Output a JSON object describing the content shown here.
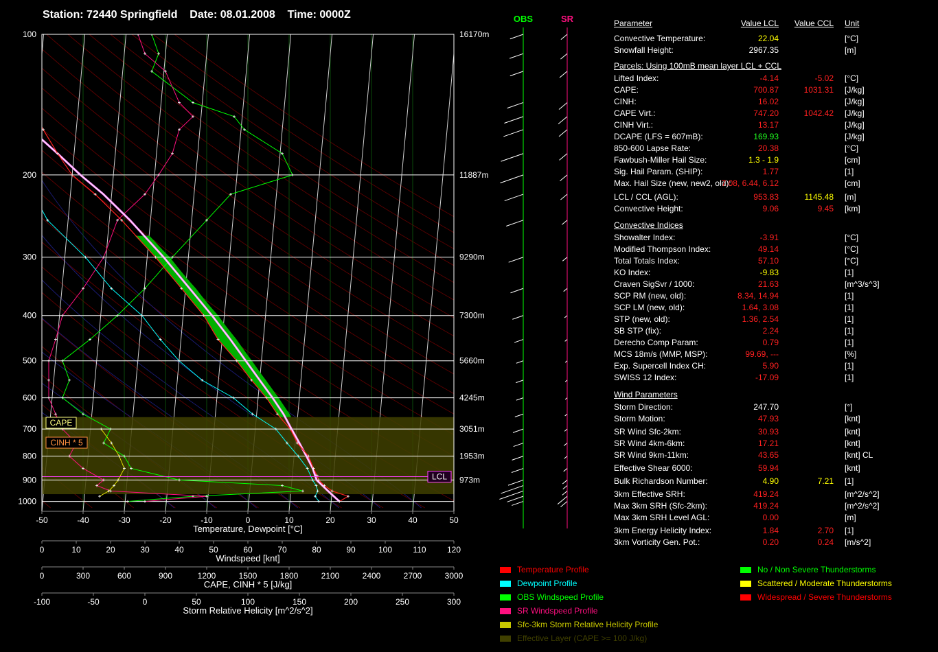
{
  "title": {
    "station": "Station: 72440 Springfield",
    "date": "Date: 08.01.2008",
    "time": "Time: 0000Z"
  },
  "chart_data": [
    {
      "type": "line",
      "name": "skew-t",
      "pressure_ticks": [
        100,
        200,
        300,
        400,
        500,
        600,
        700,
        800,
        900,
        1000
      ],
      "height_labels": [
        {
          "p": 100,
          "label": "16170m"
        },
        {
          "p": 200,
          "label": "11887m"
        },
        {
          "p": 300,
          "label": "9290m"
        },
        {
          "p": 400,
          "label": "7300m"
        },
        {
          "p": 500,
          "label": "5660m"
        },
        {
          "p": 600,
          "label": "4245m"
        },
        {
          "p": 700,
          "label": "3051m"
        },
        {
          "p": 800,
          "label": "1953m"
        },
        {
          "p": 900,
          "label": "973m"
        }
      ],
      "xlabel": "Temperature, Dewpoint [°C]",
      "xlim": [
        -50,
        50
      ],
      "xticks": [
        -50,
        -40,
        -30,
        -20,
        -10,
        0,
        10,
        20,
        30,
        40,
        50
      ],
      "ylim": [
        100,
        1050
      ],
      "box_labels": {
        "cape": "CAPE",
        "cinh": "CINH * 5",
        "lcl": "LCL"
      },
      "lcl_pressure": 885,
      "effective_layer": [
        660,
        965
      ],
      "temperature": [
        [
          1000,
          22
        ],
        [
          975,
          24
        ],
        [
          950,
          20
        ],
        [
          925,
          18
        ],
        [
          900,
          16.5
        ],
        [
          880,
          16
        ],
        [
          850,
          15
        ],
        [
          800,
          13.5
        ],
        [
          750,
          10.5
        ],
        [
          700,
          8.5
        ],
        [
          650,
          5
        ],
        [
          600,
          2
        ],
        [
          550,
          -2
        ],
        [
          500,
          -6
        ],
        [
          450,
          -11
        ],
        [
          400,
          -15
        ],
        [
          350,
          -21
        ],
        [
          300,
          -28
        ],
        [
          250,
          -37
        ],
        [
          220,
          -44
        ],
        [
          200,
          -50
        ],
        [
          180,
          -54
        ],
        [
          160,
          -58
        ],
        [
          150,
          -60
        ],
        [
          140,
          -62
        ],
        [
          120,
          -63
        ],
        [
          110,
          -62
        ],
        [
          100,
          -61
        ]
      ],
      "dewpoint": [
        [
          1000,
          17
        ],
        [
          975,
          16
        ],
        [
          950,
          16.5
        ],
        [
          925,
          16
        ],
        [
          900,
          15
        ],
        [
          850,
          13.5
        ],
        [
          800,
          11
        ],
        [
          750,
          8
        ],
        [
          700,
          5
        ],
        [
          650,
          -1
        ],
        [
          600,
          -6
        ],
        [
          550,
          -14
        ],
        [
          500,
          -20
        ],
        [
          450,
          -25
        ],
        [
          400,
          -30
        ],
        [
          350,
          -38
        ],
        [
          300,
          -45
        ],
        [
          250,
          -55
        ],
        [
          220,
          -59
        ],
        [
          200,
          -63
        ],
        [
          180,
          -66
        ],
        [
          160,
          -66
        ],
        [
          150,
          -67
        ],
        [
          140,
          -69
        ],
        [
          120,
          -73
        ],
        [
          110,
          -74
        ],
        [
          100,
          -76
        ]
      ],
      "parcel": [
        [
          1000,
          22
        ],
        [
          950,
          19
        ],
        [
          900,
          16
        ],
        [
          850,
          14.8
        ],
        [
          800,
          13
        ],
        [
          750,
          11
        ],
        [
          700,
          8.8
        ],
        [
          650,
          6.5
        ],
        [
          600,
          3.5
        ],
        [
          550,
          0
        ],
        [
          500,
          -3.8
        ],
        [
          450,
          -8
        ],
        [
          400,
          -13
        ],
        [
          350,
          -19
        ],
        [
          300,
          -26
        ],
        [
          250,
          -35
        ],
        [
          220,
          -42
        ],
        [
          200,
          -48
        ],
        [
          180,
          -54
        ],
        [
          160,
          -61
        ],
        [
          150,
          -64
        ],
        [
          140,
          -67
        ],
        [
          120,
          -73
        ],
        [
          110,
          -76
        ],
        [
          100,
          -79
        ]
      ],
      "obs_windspeed_knt": [
        [
          1000,
          25
        ],
        [
          975,
          44
        ],
        [
          950,
          76
        ],
        [
          925,
          70
        ],
        [
          900,
          40
        ],
        [
          850,
          26
        ],
        [
          800,
          24
        ],
        [
          750,
          18
        ],
        [
          700,
          20
        ],
        [
          650,
          12
        ],
        [
          600,
          6
        ],
        [
          550,
          8
        ],
        [
          500,
          6
        ],
        [
          450,
          14
        ],
        [
          400,
          22
        ],
        [
          350,
          30
        ],
        [
          300,
          38
        ],
        [
          250,
          48
        ],
        [
          220,
          55
        ],
        [
          200,
          73
        ],
        [
          180,
          70
        ],
        [
          160,
          59
        ],
        [
          150,
          56
        ],
        [
          140,
          44
        ],
        [
          120,
          32
        ],
        [
          110,
          34
        ],
        [
          100,
          32
        ]
      ],
      "sr_windspeed_knt": [
        [
          1000,
          30
        ],
        [
          975,
          48
        ],
        [
          950,
          20
        ],
        [
          925,
          16
        ],
        [
          900,
          18
        ],
        [
          850,
          12
        ],
        [
          800,
          8
        ],
        [
          750,
          10
        ],
        [
          700,
          6
        ],
        [
          650,
          4
        ],
        [
          600,
          2
        ],
        [
          550,
          2
        ],
        [
          500,
          2
        ],
        [
          450,
          4
        ],
        [
          400,
          6
        ],
        [
          350,
          12
        ],
        [
          300,
          18
        ],
        [
          250,
          22
        ],
        [
          220,
          30
        ],
        [
          200,
          34
        ],
        [
          180,
          38
        ],
        [
          160,
          40
        ],
        [
          150,
          44
        ],
        [
          140,
          40
        ],
        [
          120,
          36
        ],
        [
          110,
          30
        ],
        [
          100,
          28
        ]
      ],
      "srh_profile": [
        [
          975,
          12
        ],
        [
          950,
          30
        ],
        [
          925,
          40
        ],
        [
          900,
          48
        ],
        [
          850,
          60
        ],
        [
          800,
          50
        ],
        [
          750,
          35
        ],
        [
          700,
          15
        ]
      ],
      "windspeed_axis": {
        "label": "Windspeed [knt]",
        "ticks": [
          0,
          10,
          20,
          30,
          40,
          50,
          60,
          70,
          80,
          90,
          100,
          110,
          120
        ]
      },
      "cape_axis": {
        "label": "CAPE, CINH * 5 [J/kg]",
        "ticks": [
          0,
          300,
          600,
          900,
          1200,
          1500,
          1800,
          2100,
          2400,
          2700,
          3000
        ]
      },
      "srh_axis": {
        "label": "Storm Relative Helicity [m^2/s^2]",
        "ticks": [
          -100,
          -50,
          0,
          50,
          100,
          150,
          200,
          250,
          300
        ]
      }
    }
  ],
  "hodo_labels": {
    "obs": "OBS",
    "sr": "SR"
  },
  "params": {
    "header": {
      "parameter": "Parameter",
      "lcl": "Value LCL",
      "ccl": "Value CCL",
      "unit": "Unit"
    },
    "rows_top": [
      {
        "name": "Convective Temperature:",
        "lcl": "22.04",
        "ccl": "",
        "unit": "[°C]",
        "color": "#ffff00"
      },
      {
        "name": "Snowfall Height:",
        "lcl": "2967.35",
        "ccl": "",
        "unit": "[m]",
        "color": "#ffffff"
      }
    ],
    "section_parcels": "Parcels: Using 100mB mean layer LCL + CCL",
    "rows_parcels": [
      {
        "name": "Lifted Index:",
        "lcl": "-4.14",
        "ccl": "-5.02",
        "unit": "[°C]",
        "color": "#ff2020"
      },
      {
        "name": "CAPE:",
        "lcl": "700.87",
        "ccl": "1031.31",
        "unit": "[J/kg]",
        "color": "#ff2020"
      },
      {
        "name": "CINH:",
        "lcl": "16.02",
        "ccl": "",
        "unit": "[J/kg]",
        "color": "#ff2020"
      },
      {
        "name": "CAPE Virt.:",
        "lcl": "747.20",
        "ccl": "1042.42",
        "unit": "[J/kg]",
        "color": "#ff2020"
      },
      {
        "name": "CINH Virt.:",
        "lcl": "13.17",
        "ccl": "",
        "unit": "[J/kg]",
        "color": "#ff2020"
      },
      {
        "name": "DCAPE (LFS = 607mB):",
        "lcl": "169.93",
        "ccl": "",
        "unit": "[J/kg]",
        "color": "#20ff20"
      },
      {
        "name": "850-600 Lapse Rate:",
        "lcl": "20.38",
        "ccl": "",
        "unit": "[°C]",
        "color": "#ff2020"
      },
      {
        "name": "Fawbush-Miller Hail Size:",
        "lcl": "1.3 - 1.9",
        "ccl": "",
        "unit": "[cm]",
        "color": "#ffff00"
      },
      {
        "name": "Sig. Hail Param. (SHIP):",
        "lcl": "1.77",
        "ccl": "",
        "unit": "[1]",
        "color": "#ff2020"
      },
      {
        "name": "Max. Hail Size (new, new2, old):",
        "lcl": "7.08,  6.44,  6.12",
        "ccl": "",
        "unit": "[cm]",
        "color": "#ff2020"
      },
      {
        "name": "LCL / CCL (AGL):",
        "lcl": "953.83",
        "ccl": "1145.48",
        "unit": "[m]",
        "color": "#ff2020",
        "ccl_color": "#ffff00"
      },
      {
        "name": "Convective Height:",
        "lcl": "9.06",
        "ccl": "9.45",
        "unit": "[km]",
        "color": "#ff2020"
      }
    ],
    "section_conv": "Convective Indices",
    "rows_conv": [
      {
        "name": "Showalter Index:",
        "lcl": "-3.91",
        "unit": "[°C]",
        "color": "#ff2020"
      },
      {
        "name": "Modified Thompson Index:",
        "lcl": "49.14",
        "unit": "[°C]",
        "color": "#ff2020"
      },
      {
        "name": "Total Totals Index:",
        "lcl": "57.10",
        "unit": "[°C]",
        "color": "#ff2020"
      },
      {
        "name": "KO Index:",
        "lcl": "-9.83",
        "unit": "[1]",
        "color": "#ffff00"
      },
      {
        "name": "Craven SigSvr / 1000:",
        "lcl": "21.63",
        "unit": "[m^3/s^3]",
        "color": "#ff2020"
      },
      {
        "name": "SCP RM (new, old):",
        "lcl": "8.34,  14.94",
        "unit": "[1]",
        "color": "#ff2020"
      },
      {
        "name": "SCP LM (new, old):",
        "lcl": "1.64,  3.08",
        "unit": "[1]",
        "color": "#ff2020"
      },
      {
        "name": "STP (new, old):",
        "lcl": "1.36,  2.54",
        "unit": "[1]",
        "color": "#ff2020"
      },
      {
        "name": "SB STP (fix):",
        "lcl": "2.24",
        "unit": "[1]",
        "color": "#ff2020"
      },
      {
        "name": "Derecho Comp Param:",
        "lcl": "0.79",
        "unit": "[1]",
        "color": "#ff2020"
      },
      {
        "name": "MCS 18m/s (MMP, MSP):",
        "lcl": "99.69,  ---",
        "unit": "[%]",
        "color": "#ff2020"
      },
      {
        "name": "Exp. Supercell Index CH:",
        "lcl": "5.90",
        "unit": "[1]",
        "color": "#ff2020"
      },
      {
        "name": "SWISS 12 Index:",
        "lcl": "-17.09",
        "unit": "[1]",
        "color": "#ff2020"
      }
    ],
    "section_wind": "Wind Parameters",
    "rows_wind": [
      {
        "name": "Storm Direction:",
        "lcl": "247.70",
        "ccl": "",
        "unit": "[°]",
        "color": "#ffffff"
      },
      {
        "name": "Storm Motion:",
        "lcl": "47.93",
        "ccl": "",
        "unit": "[knt]",
        "color": "#ff2020"
      },
      {
        "name": "SR Wind Sfc-2km:",
        "lcl": "30.93",
        "ccl": "",
        "unit": "[knt]",
        "color": "#ff2020"
      },
      {
        "name": "SR Wind 4km-6km:",
        "lcl": "17.21",
        "ccl": "",
        "unit": "[knt]",
        "color": "#ff2020"
      },
      {
        "name": "SR Wind 9km-11km:",
        "lcl": "43.65",
        "ccl": "",
        "unit": "[knt] CL",
        "color": "#ff2020"
      },
      {
        "name": "Effective Shear 6000:",
        "lcl": "59.94",
        "ccl": "",
        "unit": "[knt]",
        "color": "#ff2020"
      },
      {
        "name": "Bulk Richardson Number:",
        "lcl": "4.90",
        "ccl": "7.21",
        "unit": "[1]",
        "color": "#ffff00"
      },
      {
        "name": "3km Effective SRH:",
        "lcl": "419.24",
        "ccl": "",
        "unit": "[m^2/s^2]",
        "color": "#ff2020"
      },
      {
        "name": "Max 3km SRH (Sfc-2km):",
        "lcl": "419.24",
        "ccl": "",
        "unit": "[m^2/s^2]",
        "color": "#ff2020"
      },
      {
        "name": "Max 3km SRH Level AGL:",
        "lcl": "0.00",
        "ccl": "",
        "unit": "[m]",
        "color": "#ff2020"
      },
      {
        "name": "3km Energy Helicity Index:",
        "lcl": "1.84",
        "ccl": "2.70",
        "unit": "[1]",
        "color": "#ff2020"
      },
      {
        "name": "3km Vorticity Gen. Pot.:",
        "lcl": "0.20",
        "ccl": "0.24",
        "unit": "[m/s^2]",
        "color": "#ff2020"
      }
    ]
  },
  "legend": [
    {
      "label": "Temperature Profile",
      "color": "#ff0000"
    },
    {
      "label": "Dewpoint Profile",
      "color": "#00ffff"
    },
    {
      "label": "OBS Windspeed Profile",
      "color": "#00ff00"
    },
    {
      "label": "SR Windspeed Profile",
      "color": "#ff1080"
    },
    {
      "label": "Sfc-3km Storm Relative Helicity Profile",
      "color": "#c8c800"
    },
    {
      "label": "Effective Layer (CAPE >= 100 J/kg)",
      "color": "#404000"
    },
    {
      "label": "No / Non Severe Thunderstorms",
      "color": "#00ff00"
    },
    {
      "label": "Scattered / Moderate Thunderstorms",
      "color": "#ffff00"
    },
    {
      "label": "Widespread / Severe Thunderstorms",
      "color": "#ff0000"
    }
  ]
}
